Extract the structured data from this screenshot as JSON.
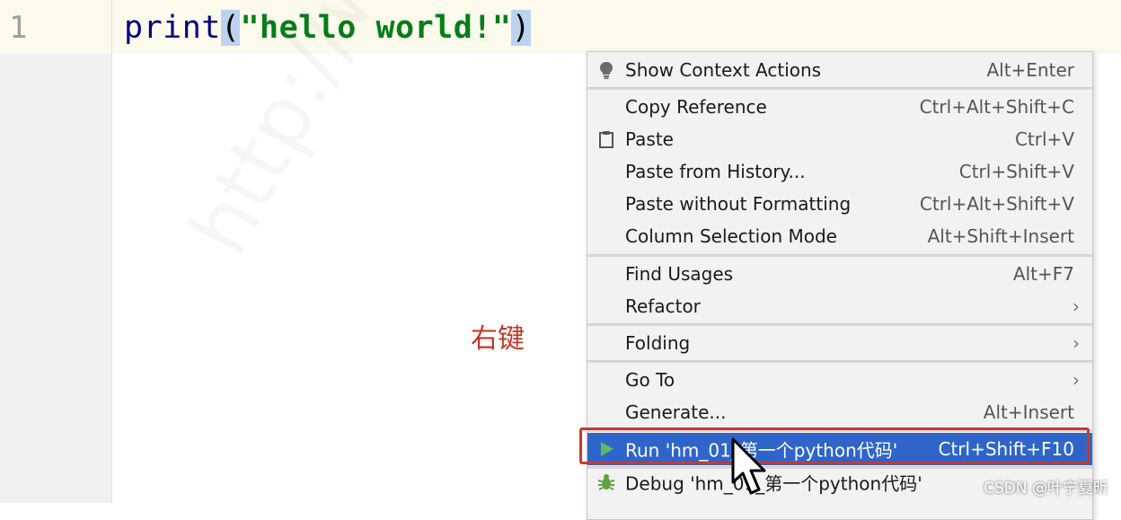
{
  "editor": {
    "line_number": "1",
    "code": {
      "function": "print",
      "open_paren": "(",
      "string": "\"hello world!\"",
      "close_paren": ")"
    }
  },
  "annotation": "右键",
  "watermark": "http://www",
  "credit": "CSDN @叶宁夏昕",
  "context_menu": {
    "show_context_actions": {
      "label": "Show Context Actions",
      "shortcut": "Alt+Enter"
    },
    "copy_reference": {
      "label": "Copy Reference",
      "shortcut": "Ctrl+Alt+Shift+C"
    },
    "paste": {
      "label": "Paste",
      "shortcut": "Ctrl+V"
    },
    "paste_from_history": {
      "label": "Paste from History...",
      "shortcut": "Ctrl+Shift+V"
    },
    "paste_without_formatting": {
      "label": "Paste without Formatting",
      "shortcut": "Ctrl+Alt+Shift+V"
    },
    "column_selection_mode": {
      "label": "Column Selection Mode",
      "shortcut": "Alt+Shift+Insert"
    },
    "find_usages": {
      "label": "Find Usages",
      "shortcut": "Alt+F7"
    },
    "refactor": {
      "label": "Refactor"
    },
    "folding": {
      "label": "Folding"
    },
    "go_to": {
      "label": "Go To"
    },
    "generate": {
      "label": "Generate...",
      "shortcut": "Alt+Insert"
    },
    "run": {
      "label": "Run 'hm_01_第一个python代码'",
      "shortcut": "Ctrl+Shift+F10"
    },
    "debug": {
      "label": "Debug 'hm_01_第一个python代码'"
    }
  },
  "colors": {
    "selection_bg": "#2f65ca",
    "highlight_border": "#c73a2e",
    "annotation_text": "#c0392b",
    "string_token": "#067d17",
    "function_token": "#000080"
  },
  "icons": {
    "show_context_actions": "lightbulb-icon",
    "paste": "clipboard-icon",
    "run": "run-triangle-icon",
    "debug": "debug-bug-icon",
    "submenu": "chevron-right-icon",
    "pointer": "mouse-pointer-icon"
  }
}
